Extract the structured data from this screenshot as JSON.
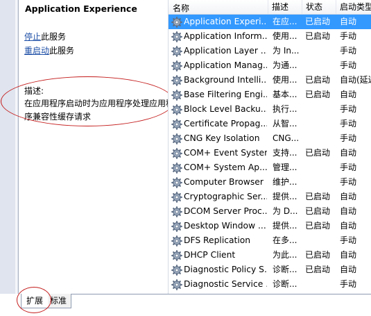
{
  "ext_pane": {
    "service_title": "Application Experience",
    "stop_link": "停止",
    "stop_suffix": "此服务",
    "restart_link": "重启动",
    "restart_suffix": "此服务",
    "description_label": "描述:",
    "description_text": "在应用程序启动时为应用程序处理应用程序兼容性缓存请求"
  },
  "columns": {
    "name": "名称",
    "description": "描述",
    "status": "状态",
    "startup": "启动类型"
  },
  "services": [
    {
      "name": "Application Experi...",
      "desc": "在应...",
      "status": "已启动",
      "startup": "自动",
      "selected": true
    },
    {
      "name": "Application Inform...",
      "desc": "使用...",
      "status": "已启动",
      "startup": "手动"
    },
    {
      "name": "Application Layer ...",
      "desc": "为 In...",
      "status": "",
      "startup": "手动"
    },
    {
      "name": "Application Manag...",
      "desc": "为通...",
      "status": "",
      "startup": "手动"
    },
    {
      "name": "Background Intelli...",
      "desc": "使用...",
      "status": "已启动",
      "startup": "自动(延迟"
    },
    {
      "name": "Base Filtering Engi...",
      "desc": "基本...",
      "status": "已启动",
      "startup": "自动"
    },
    {
      "name": "Block Level Backu...",
      "desc": "执行...",
      "status": "",
      "startup": "手动"
    },
    {
      "name": "Certificate Propag...",
      "desc": "从智...",
      "status": "",
      "startup": "手动"
    },
    {
      "name": "CNG Key Isolation",
      "desc": "CNG...",
      "status": "",
      "startup": "手动"
    },
    {
      "name": "COM+ Event System",
      "desc": "支持...",
      "status": "已启动",
      "startup": "自动"
    },
    {
      "name": "COM+ System Ap...",
      "desc": "管理...",
      "status": "",
      "startup": "手动"
    },
    {
      "name": "Computer Browser",
      "desc": "维护...",
      "status": "",
      "startup": "手动"
    },
    {
      "name": "Cryptographic Ser...",
      "desc": "提供...",
      "status": "已启动",
      "startup": "自动"
    },
    {
      "name": "DCOM Server Proc...",
      "desc": "为 D...",
      "status": "已启动",
      "startup": "自动"
    },
    {
      "name": "Desktop Window ...",
      "desc": "提供...",
      "status": "已启动",
      "startup": "自动"
    },
    {
      "name": "DFS Replication",
      "desc": "在多...",
      "status": "",
      "startup": "手动"
    },
    {
      "name": "DHCP Client",
      "desc": "为此...",
      "status": "已启动",
      "startup": "自动"
    },
    {
      "name": "Diagnostic Policy S...",
      "desc": "诊断...",
      "status": "已启动",
      "startup": "自动"
    },
    {
      "name": "Diagnostic Service ...",
      "desc": "诊断...",
      "status": "",
      "startup": "手动"
    }
  ],
  "tabs": {
    "extended": "扩展",
    "standard": "标准"
  },
  "icons": {
    "service": "gear-icon"
  },
  "colors": {
    "selection": "#3399ff",
    "annotation": "#c41a1a",
    "link": "#1e4fa6"
  }
}
